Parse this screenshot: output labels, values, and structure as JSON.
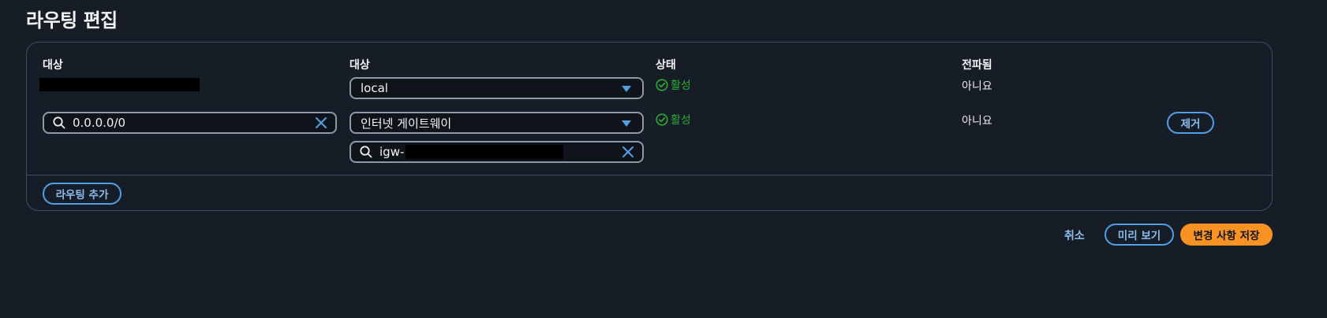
{
  "page": {
    "title": "라우팅 편집"
  },
  "table": {
    "headers": {
      "destination": "대상",
      "target": "대상",
      "status": "상태",
      "propagated": "전파됨"
    },
    "rows": [
      {
        "target": "local",
        "status": "활성",
        "propagated": "아니요"
      },
      {
        "destination": "0.0.0.0/0",
        "target": "인터넷 게이트웨이",
        "target_search": "igw-",
        "status": "활성",
        "propagated": "아니요",
        "remove_label": "제거"
      }
    ],
    "add_route_label": "라우팅 추가"
  },
  "footer": {
    "cancel_label": "취소",
    "preview_label": "미리 보기",
    "save_label": "변경 사항 저장"
  },
  "colors": {
    "background": "#161d26",
    "accent": "#539fe5",
    "primary": "#f89223",
    "success": "#29ad32"
  },
  "icons": [
    "search-icon",
    "clear-icon",
    "caret-down-icon",
    "status-ok-icon"
  ]
}
